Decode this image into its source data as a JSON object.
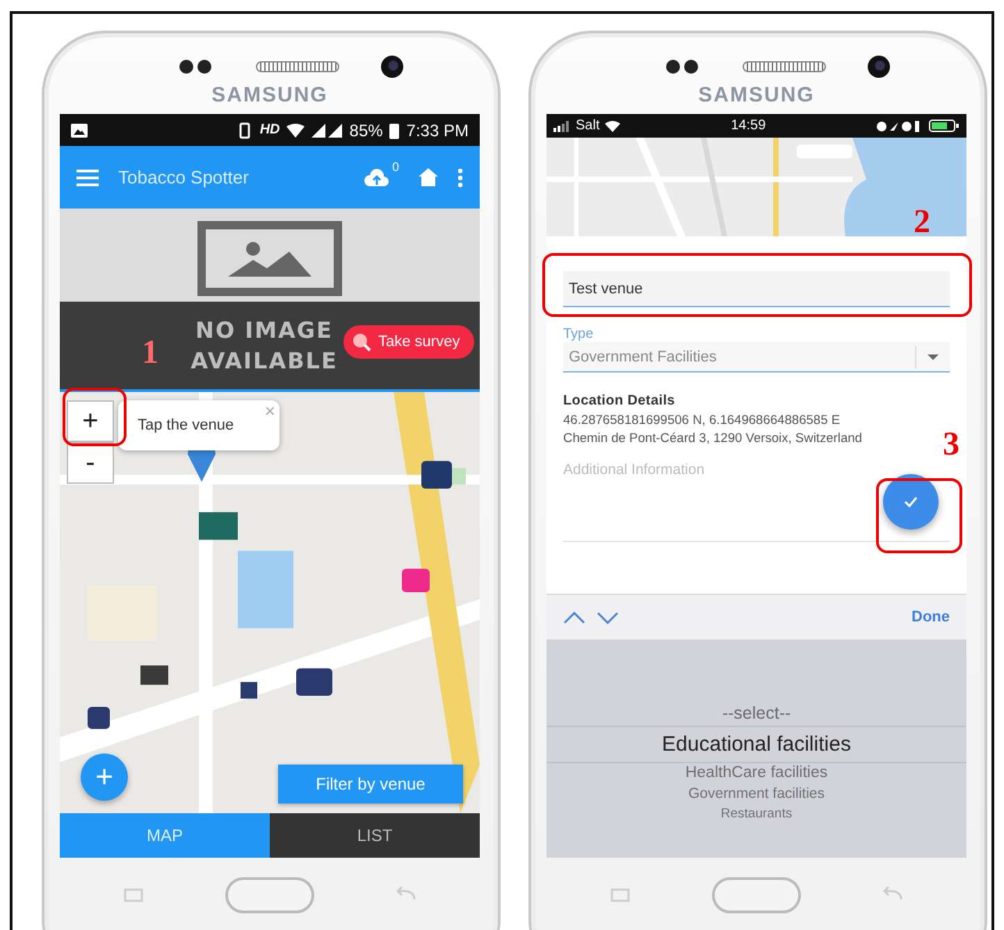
{
  "phones": [
    {
      "brand": "SAMSUNG"
    },
    {
      "brand": "SAMSUNG"
    }
  ],
  "map_screen": {
    "status_bar": {
      "network": "HD",
      "battery": "85%",
      "time": "7:33 PM"
    },
    "app_bar": {
      "title": "Tobacco Spotter",
      "sync_count": "0"
    },
    "banner": {
      "caption_lines": [
        "NO IMAGE",
        "AVAILABLE"
      ],
      "survey_button": "Take survey"
    },
    "annotation": "1",
    "zoom_controls": [
      "+",
      "-"
    ],
    "tooltip": {
      "text": "Tap the venue",
      "close": "×"
    },
    "add_button": "+",
    "filter_button": "Filter by venue",
    "tabs": [
      {
        "label": "MAP",
        "selected": true
      },
      {
        "label": "LIST",
        "selected": false
      }
    ]
  },
  "form_screen": {
    "status_bar": {
      "carrier": "Salt",
      "time": "14:59"
    },
    "annotations": [
      "2",
      "3"
    ],
    "name_field": {
      "value": "Test venue"
    },
    "type_field": {
      "label": "Type",
      "value": "Government Facilities"
    },
    "location": {
      "heading": "Location Details",
      "coordinates": "46.287658181699506 N, 6.164968664886585 E",
      "address": "Chemin de Pont-Céard 3, 1290 Versoix, Switzerland"
    },
    "additional_info": {
      "placeholder": "Additional Information"
    },
    "keyboard_bar": {
      "done": "Done"
    },
    "picker": [
      {
        "label": "--select--",
        "selected": false
      },
      {
        "label": "Educational facilities",
        "selected": true
      },
      {
        "label": "HealthCare facilities",
        "selected": false
      },
      {
        "label": "Government facilities",
        "selected": false
      },
      {
        "label": "Restaurants",
        "selected": false
      }
    ]
  }
}
